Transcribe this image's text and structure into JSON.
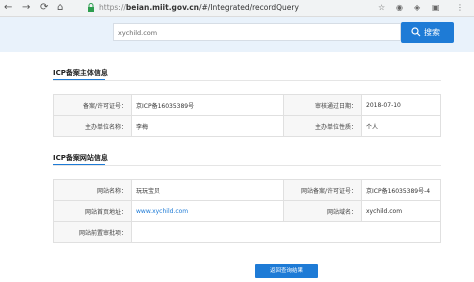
{
  "browser": {
    "url_scheme": "https://",
    "url_host": "beian.miit.gov.cn",
    "url_path": "/#/Integrated/recordQuery"
  },
  "search": {
    "value": "xychild.com",
    "button_label": "搜索"
  },
  "subject_section": {
    "title": "ICP备案主体信息",
    "rows": [
      {
        "label1": "备案/许可证号：",
        "value1": "京ICP备16035389号",
        "label2": "审核通过日期：",
        "value2": "2018-07-10"
      },
      {
        "label1": "主办单位名称：",
        "value1": "李梅",
        "label2": "主办单位性质：",
        "value2": "个人"
      }
    ]
  },
  "site_section": {
    "title": "ICP备案网站信息",
    "rows": [
      {
        "label1": "网站名称：",
        "value1": "玩玩宝贝",
        "label2": "网站备案/许可证号：",
        "value2": "京ICP备16035389号-4"
      },
      {
        "label1": "网站首页地址：",
        "value1": "www.xychild.com",
        "label2": "网站域名：",
        "value2": "xychild.com"
      }
    ],
    "approval_label": "网站前置审批项：",
    "approval_value": ""
  },
  "back_button_label": "返回查询结果",
  "colors": {
    "accent": "#1e7bd6",
    "strip": "#e9f2fb"
  }
}
